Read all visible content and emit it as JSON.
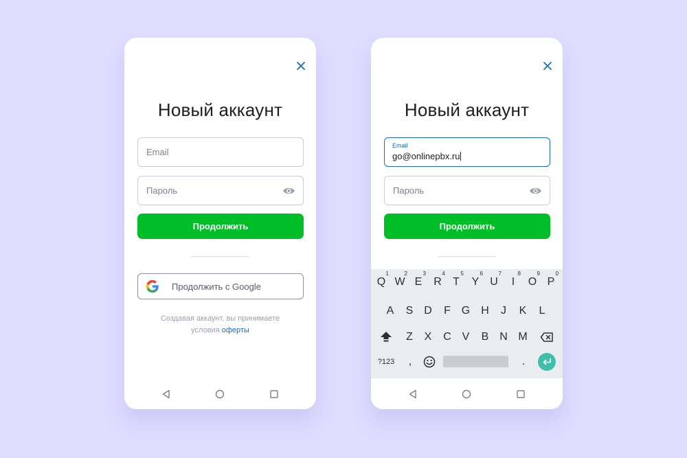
{
  "screens": [
    {
      "title": "Новый аккаунт",
      "email_placeholder": "Email",
      "password_placeholder": "Пароль",
      "continue_label": "Продолжить",
      "google_label": "Продолжить с Google",
      "terms_text": "Создавая аккаунт, вы принимаете",
      "terms_prefix": "условия",
      "terms_link": "оферты"
    },
    {
      "title": "Новый аккаунт",
      "email_label": "Email",
      "email_value": "go@onlinepbx.ru",
      "password_placeholder": "Пароль",
      "continue_label": "Продолжить"
    }
  ],
  "keyboard": {
    "row1": [
      {
        "k": "Q",
        "h": "1"
      },
      {
        "k": "W",
        "h": "2"
      },
      {
        "k": "E",
        "h": "3"
      },
      {
        "k": "R",
        "h": "4"
      },
      {
        "k": "T",
        "h": "5"
      },
      {
        "k": "Y",
        "h": "6"
      },
      {
        "k": "U",
        "h": "7"
      },
      {
        "k": "I",
        "h": "8"
      },
      {
        "k": "O",
        "h": "9"
      },
      {
        "k": "P",
        "h": "0"
      }
    ],
    "row2": [
      "A",
      "S",
      "D",
      "F",
      "G",
      "H",
      "J",
      "K",
      "L"
    ],
    "row3": [
      "Z",
      "X",
      "C",
      "V",
      "B",
      "N",
      "M"
    ],
    "symbols_label": "?123",
    "comma": ",",
    "period": "."
  },
  "colors": {
    "background": "#dedcff",
    "primary_green": "#00be28",
    "accent_blue": "#1c6bb8",
    "enter_key": "#3fbfa9"
  },
  "icons": [
    "close-icon",
    "eye-icon",
    "google-icon",
    "nav-back-icon",
    "nav-home-icon",
    "nav-recents-icon",
    "shift-icon",
    "backspace-icon",
    "emoji-icon",
    "enter-icon"
  ]
}
